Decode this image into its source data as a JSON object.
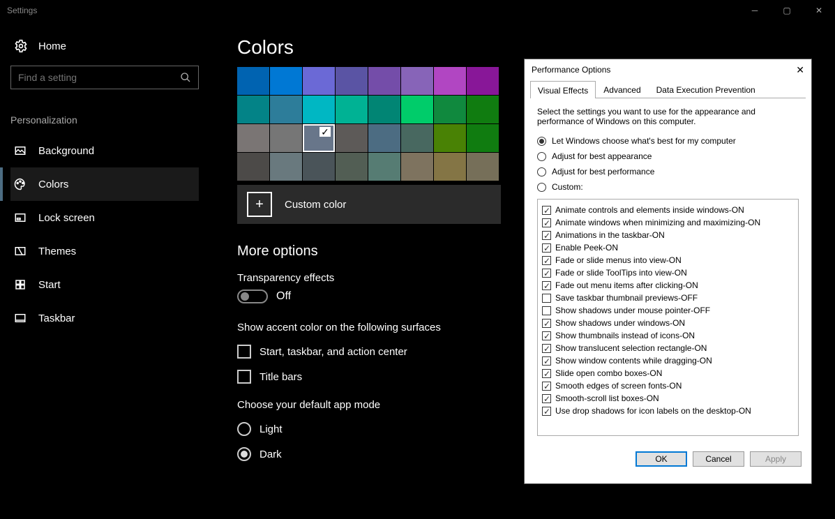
{
  "titlebar": {
    "title": "Settings"
  },
  "sidebar": {
    "home": "Home",
    "search_placeholder": "Find a setting",
    "group": "Personalization",
    "items": [
      {
        "label": "Background"
      },
      {
        "label": "Colors"
      },
      {
        "label": "Lock screen"
      },
      {
        "label": "Themes"
      },
      {
        "label": "Start"
      },
      {
        "label": "Taskbar"
      }
    ]
  },
  "main": {
    "heading": "Colors",
    "palette": [
      [
        "#0063b1",
        "#0078d4",
        "#6b69d6",
        "#5a54a4",
        "#744da9",
        "#8764b8",
        "#b146c2",
        "#881798"
      ],
      [
        "#038387",
        "#2d7d9a",
        "#00b7c3",
        "#00b294",
        "#018574",
        "#00cc6a",
        "#10893e",
        "#107c10"
      ],
      [
        "#7a7574",
        "#767676",
        "#68768a",
        "#5d5a58",
        "#4c6c82",
        "#486860",
        "#498205",
        "#107c10"
      ],
      [
        "#4c4a48",
        "#69797e",
        "#4a5459",
        "#525e54",
        "#567c73",
        "#7e735f",
        "#847545",
        "#766f59"
      ]
    ],
    "selected_index": 18,
    "custom_label": "Custom color",
    "more_heading": "More options",
    "transparency_label": "Transparency effects",
    "transparency_state": "Off",
    "accent_heading": "Show accent color on the following surfaces",
    "accent_start": "Start, taskbar, and action center",
    "accent_titlebars": "Title bars",
    "appmode_heading": "Choose your default app mode",
    "appmode_light": "Light",
    "appmode_dark": "Dark"
  },
  "dialog": {
    "title": "Performance Options",
    "tabs": [
      "Visual Effects",
      "Advanced",
      "Data Execution Prevention"
    ],
    "desc": "Select the settings you want to use for the appearance and performance of Windows on this computer.",
    "radios": [
      {
        "label": "Let Windows choose what's best for my computer",
        "on": true
      },
      {
        "label": "Adjust for best appearance",
        "on": false
      },
      {
        "label": "Adjust for best performance",
        "on": false
      },
      {
        "label": "Custom:",
        "on": false
      }
    ],
    "effects": [
      {
        "label": "Animate controls and elements inside windows-ON",
        "on": true
      },
      {
        "label": "Animate windows when minimizing and maximizing-ON",
        "on": true
      },
      {
        "label": "Animations in the taskbar-ON",
        "on": true
      },
      {
        "label": "Enable Peek-ON",
        "on": true
      },
      {
        "label": "Fade or slide menus into view-ON",
        "on": true
      },
      {
        "label": "Fade or slide ToolTips into view-ON",
        "on": true
      },
      {
        "label": "Fade out menu items after clicking-ON",
        "on": true
      },
      {
        "label": "Save taskbar thumbnail previews-OFF",
        "on": false
      },
      {
        "label": "Show shadows under mouse pointer-OFF",
        "on": false
      },
      {
        "label": "Show shadows under windows-ON",
        "on": true
      },
      {
        "label": "Show thumbnails instead of icons-ON",
        "on": true
      },
      {
        "label": "Show translucent selection rectangle-ON",
        "on": true
      },
      {
        "label": "Show window contents while dragging-ON",
        "on": true
      },
      {
        "label": "Slide open combo boxes-ON",
        "on": true
      },
      {
        "label": "Smooth edges of screen fonts-ON",
        "on": true
      },
      {
        "label": "Smooth-scroll list boxes-ON",
        "on": true
      },
      {
        "label": "Use drop shadows for icon labels on the desktop-ON",
        "on": true
      }
    ],
    "buttons": {
      "ok": "OK",
      "cancel": "Cancel",
      "apply": "Apply"
    }
  }
}
